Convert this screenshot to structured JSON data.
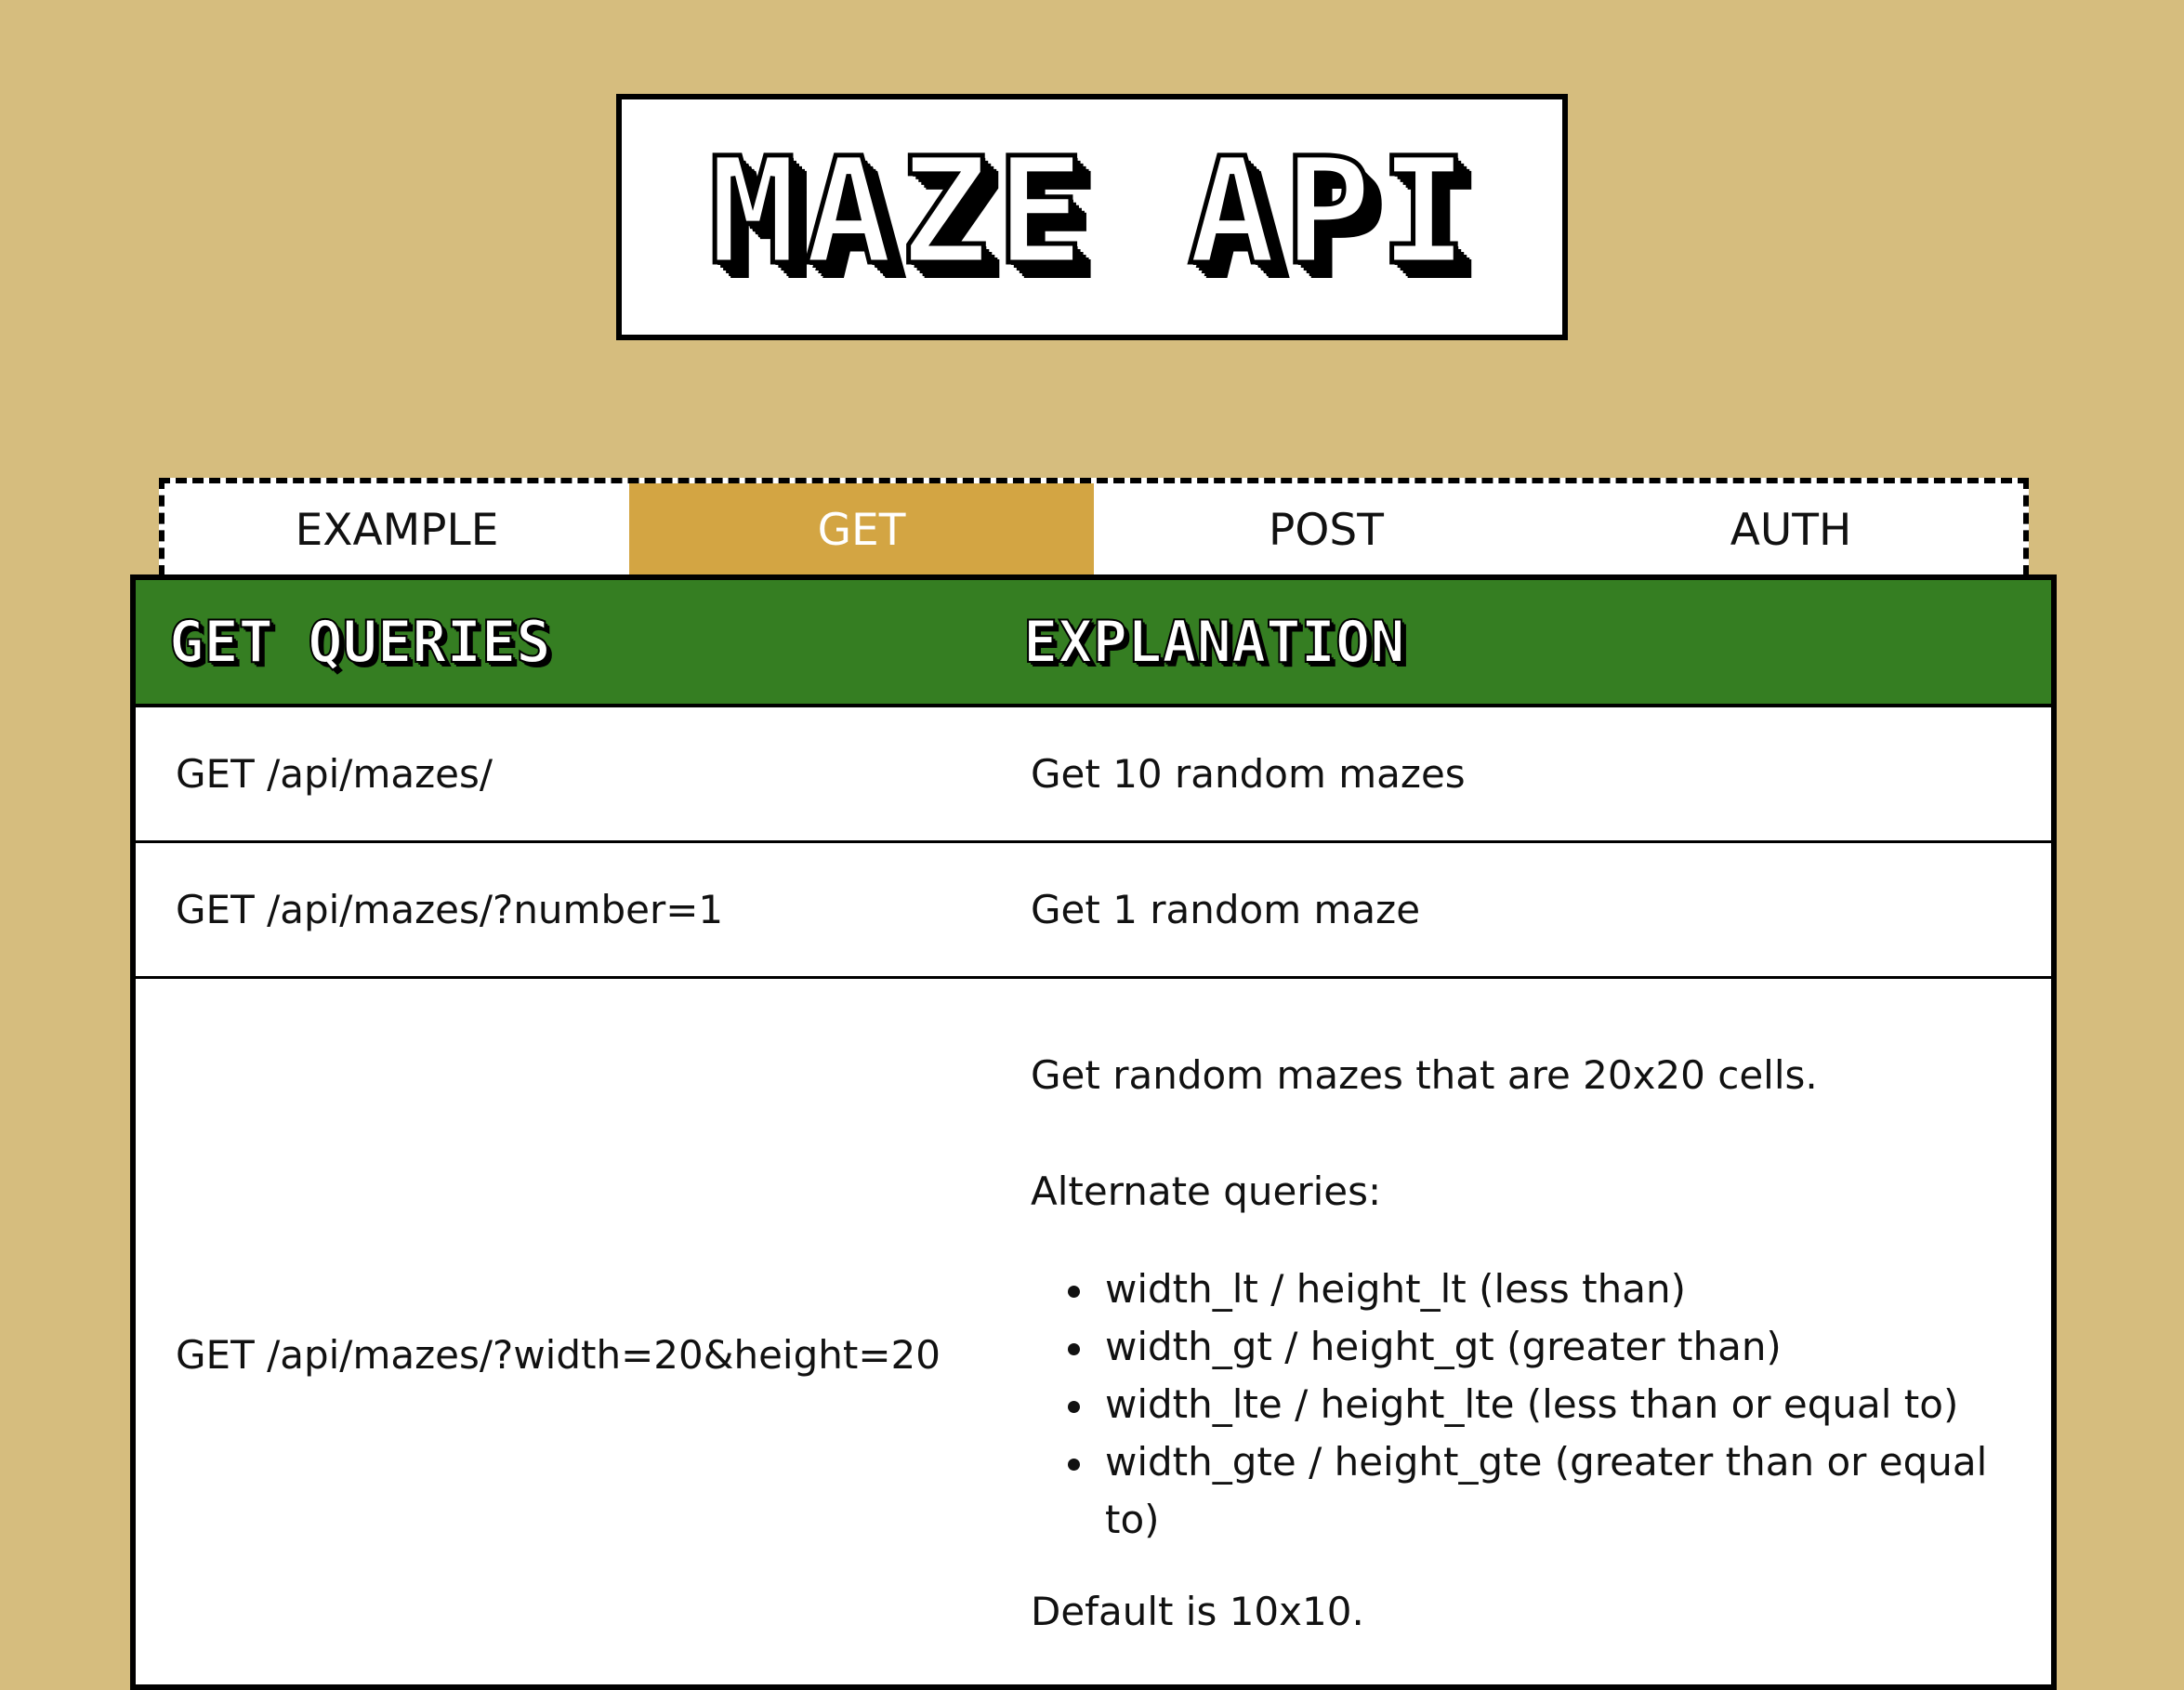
{
  "logo": {
    "title": "MAZE API"
  },
  "tabs": [
    {
      "label": "EXAMPLE",
      "active": false
    },
    {
      "label": "GET",
      "active": true
    },
    {
      "label": "POST",
      "active": false
    },
    {
      "label": "AUTH",
      "active": false
    }
  ],
  "table": {
    "headers": {
      "queries": "GET QUERIES",
      "explanation": "EXPLANATION"
    },
    "rows": [
      {
        "query": "GET /api/mazes/",
        "explanation": "Get 10 random mazes"
      },
      {
        "query": "GET /api/mazes/?number=1",
        "explanation": "Get 1 random maze"
      },
      {
        "query": "GET /api/mazes/?width=20&height=20",
        "explanation": "Get random mazes that are 20x20 cells.",
        "alternate_label": "Alternate queries:",
        "alternates": [
          "width_lt / height_lt (less than)",
          "width_gt / height_gt (greater than)",
          "width_lte / height_lte (less than or equal to)",
          "width_gte / height_gte (greater than or equal to)"
        ],
        "default_note": "Default is 10x10."
      }
    ]
  },
  "colors": {
    "background": "#d6bd7e",
    "active_tab": "#d3a543",
    "header_green": "#357e22"
  }
}
